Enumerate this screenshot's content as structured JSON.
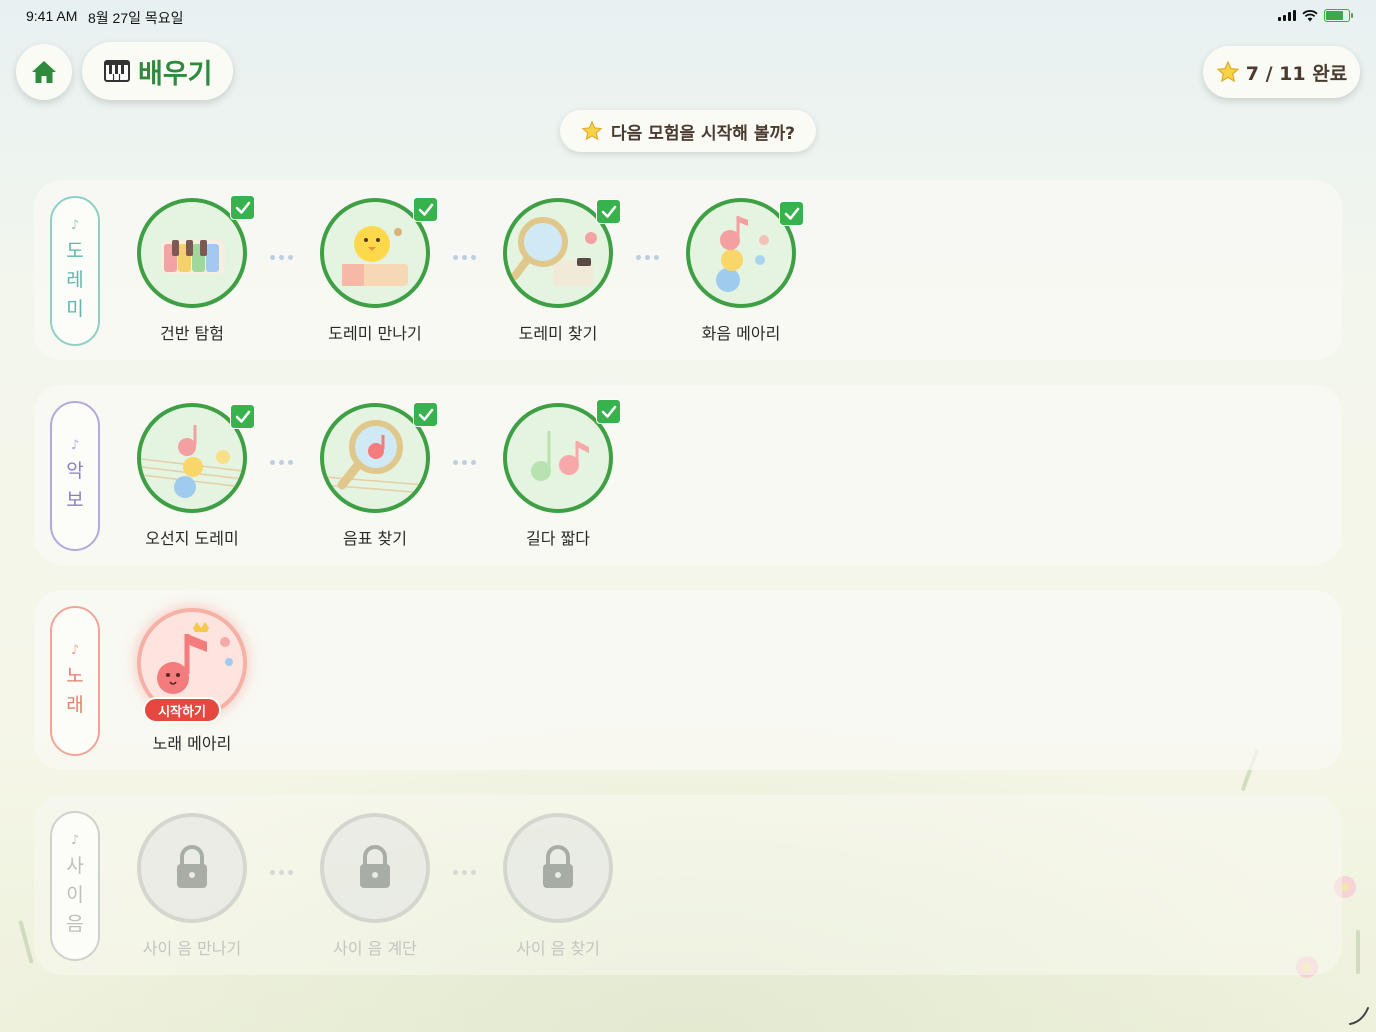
{
  "status_bar": {
    "time": "9:41 AM",
    "date": "8월 27일 목요일",
    "icons": [
      "signal-icon",
      "wifi-icon",
      "battery-charging-icon"
    ]
  },
  "header": {
    "home_icon": "home-icon",
    "learn_icon": "piano-icon",
    "learn_title": "배우기",
    "progress_icon": "star-icon",
    "progress_text": "7 / 11 완료",
    "hint_icon": "star-icon",
    "hint_text": "다음 모험을 시작해 볼까?"
  },
  "colors": {
    "accent_green": "#3f9f45",
    "check_green": "#37b24d",
    "start_red": "#e5483e",
    "label_teal": "#8fcfc6",
    "label_purple": "#b5a8e0",
    "label_coral": "#f1a597"
  },
  "rows": [
    {
      "label": "도레미",
      "lessons": [
        {
          "name": "건반 탐험",
          "icon": "piano-keys-icon",
          "state": "completed"
        },
        {
          "name": "도레미 만나기",
          "icon": "chick-on-keys-icon",
          "state": "completed"
        },
        {
          "name": "도레미 찾기",
          "icon": "magnifier-keys-icon",
          "state": "completed"
        },
        {
          "name": "화음 메아리",
          "icon": "stacked-notes-icon",
          "state": "completed"
        }
      ]
    },
    {
      "label": "악보",
      "lessons": [
        {
          "name": "오선지 도레미",
          "icon": "notes-on-staff-icon",
          "state": "completed"
        },
        {
          "name": "음표 찾기",
          "icon": "magnifier-note-icon",
          "state": "completed"
        },
        {
          "name": "길다 짧다",
          "icon": "long-short-notes-icon",
          "state": "completed"
        }
      ]
    },
    {
      "label": "노래",
      "lessons": [
        {
          "name": "노래 메아리",
          "icon": "singing-note-icon",
          "state": "current",
          "badge": "시작하기"
        }
      ]
    },
    {
      "label": "사이 음",
      "lessons": [
        {
          "name": "사이 음 만나기",
          "icon": "lock-icon",
          "state": "locked"
        },
        {
          "name": "사이 음 계단",
          "icon": "lock-icon",
          "state": "locked"
        },
        {
          "name": "사이 음 찾기",
          "icon": "lock-icon",
          "state": "locked"
        }
      ]
    }
  ]
}
